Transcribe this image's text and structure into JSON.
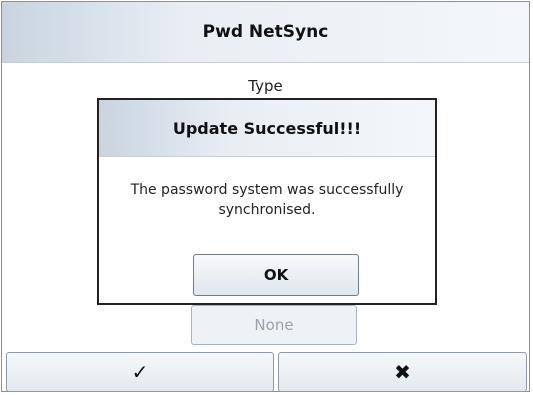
{
  "window": {
    "title": "Pwd NetSync",
    "type_label": "Type",
    "background_option": "None"
  },
  "toolbar": {
    "confirm_glyph": "✓",
    "cancel_glyph": "✖",
    "confirm_icon": "checkmark-icon",
    "cancel_icon": "close-icon"
  },
  "dialog": {
    "title": "Update Successful!!!",
    "message_line1": "The password system was successfully",
    "message_line2": "synchronised.",
    "ok_label": "OK"
  },
  "colors": {
    "title_gradient_start": "#c9d4e0",
    "button_border": "#8f9aa6",
    "disabled_text": "#9aa3ad"
  }
}
